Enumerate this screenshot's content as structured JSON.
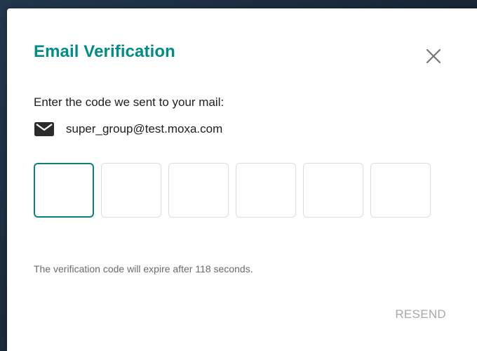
{
  "dialog": {
    "title": "Email Verification",
    "prompt": "Enter the code we sent to your mail:",
    "email": "super_group@test.moxa.com",
    "code_digits": [
      "",
      "",
      "",
      "",
      "",
      ""
    ],
    "expire_prefix": "The verification code will expire after ",
    "expire_seconds": "118",
    "expire_suffix": " seconds.",
    "resend_label": "RESEND"
  },
  "icons": {
    "close": "close-icon",
    "mail": "mail-icon"
  },
  "colors": {
    "accent": "#008c87",
    "active_border": "#0e7f79",
    "disabled_text": "#a8a8a8"
  }
}
